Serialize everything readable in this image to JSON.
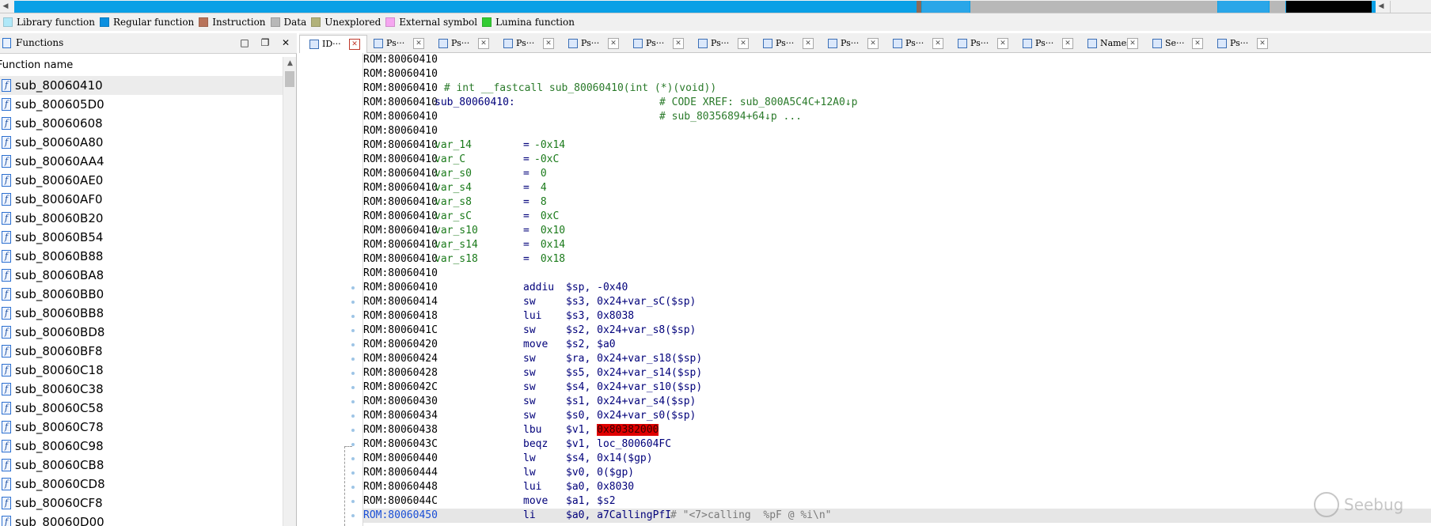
{
  "legend": [
    {
      "label": "Library function",
      "color": "#b0e8f8"
    },
    {
      "label": "Regular function",
      "color": "#0a8fe0"
    },
    {
      "label": "Instruction",
      "color": "#b8735a"
    },
    {
      "label": "Data",
      "color": "#b8b8b8"
    },
    {
      "label": "Unexplored",
      "color": "#b2b27a"
    },
    {
      "label": "External symbol",
      "color": "#f5a6f0"
    },
    {
      "label": "Lumina function",
      "color": "#33cc33"
    }
  ],
  "functions_panel": {
    "title": "Functions",
    "column_header": "Function name",
    "items": [
      "sub_80060410",
      "sub_800605D0",
      "sub_80060608",
      "sub_80060A80",
      "sub_80060AA4",
      "sub_80060AE0",
      "sub_80060AF0",
      "sub_80060B20",
      "sub_80060B54",
      "sub_80060B88",
      "sub_80060BA8",
      "sub_80060BB0",
      "sub_80060BB8",
      "sub_80060BD8",
      "sub_80060BF8",
      "sub_80060C18",
      "sub_80060C38",
      "sub_80060C58",
      "sub_80060C78",
      "sub_80060C98",
      "sub_80060CB8",
      "sub_80060CD8",
      "sub_80060CF8",
      "sub_80060D00"
    ],
    "selected_index": 0
  },
  "tabs": [
    {
      "label": "ID···",
      "active": true
    },
    {
      "label": "Ps···"
    },
    {
      "label": "Ps···"
    },
    {
      "label": "Ps···"
    },
    {
      "label": "Ps···"
    },
    {
      "label": "Ps···"
    },
    {
      "label": "Ps···"
    },
    {
      "label": "Ps···"
    },
    {
      "label": "Ps···"
    },
    {
      "label": "Ps···"
    },
    {
      "label": "Ps···"
    },
    {
      "label": "Ps···"
    },
    {
      "label": "Names"
    },
    {
      "label": "Se···"
    },
    {
      "label": "Ps···"
    }
  ],
  "disasm": {
    "lines": [
      {
        "addr": "ROM:80060410"
      },
      {
        "addr": "ROM:80060410"
      },
      {
        "addr": "ROM:80060410",
        "comment_inline": " # int __fastcall sub_80060410(int (*)(void))"
      },
      {
        "addr": "ROM:80060410",
        "label": "sub_80060410:",
        "xref": "# CODE XREF: sub_800A5C4C+12A0↓p"
      },
      {
        "addr": "ROM:80060410",
        "xref": "# sub_80356894+64↓p ..."
      },
      {
        "addr": "ROM:80060410"
      },
      {
        "addr": "ROM:80060410",
        "var": "var_14",
        "val": "-0x14"
      },
      {
        "addr": "ROM:80060410",
        "var": "var_C",
        "val": "-0xC"
      },
      {
        "addr": "ROM:80060410",
        "var": "var_s0",
        "val": " 0"
      },
      {
        "addr": "ROM:80060410",
        "var": "var_s4",
        "val": " 4"
      },
      {
        "addr": "ROM:80060410",
        "var": "var_s8",
        "val": " 8"
      },
      {
        "addr": "ROM:80060410",
        "var": "var_sC",
        "val": " 0xC"
      },
      {
        "addr": "ROM:80060410",
        "var": "var_s10",
        "val": " 0x10"
      },
      {
        "addr": "ROM:80060410",
        "var": "var_s14",
        "val": " 0x14"
      },
      {
        "addr": "ROM:80060410",
        "var": "var_s18",
        "val": " 0x18"
      },
      {
        "addr": "ROM:80060410"
      },
      {
        "addr": "ROM:80060410",
        "mn": "addiu",
        "op": "$sp, -0x40"
      },
      {
        "addr": "ROM:80060414",
        "mn": "sw",
        "op": "$s3, 0x24+var_sC($sp)"
      },
      {
        "addr": "ROM:80060418",
        "mn": "lui",
        "op": "$s3, 0x8038"
      },
      {
        "addr": "ROM:8006041C",
        "mn": "sw",
        "op": "$s2, 0x24+var_s8($sp)"
      },
      {
        "addr": "ROM:80060420",
        "mn": "move",
        "op": "$s2, $a0"
      },
      {
        "addr": "ROM:80060424",
        "mn": "sw",
        "op": "$ra, 0x24+var_s18($sp)"
      },
      {
        "addr": "ROM:80060428",
        "mn": "sw",
        "op": "$s5, 0x24+var_s14($sp)"
      },
      {
        "addr": "ROM:8006042C",
        "mn": "sw",
        "op": "$s4, 0x24+var_s10($sp)"
      },
      {
        "addr": "ROM:80060430",
        "mn": "sw",
        "op": "$s1, 0x24+var_s4($sp)"
      },
      {
        "addr": "ROM:80060434",
        "mn": "sw",
        "op": "$s0, 0x24+var_s0($sp)"
      },
      {
        "addr": "ROM:80060438",
        "mn": "lbu",
        "op": "$v1, ",
        "op_mark": "0x80382000"
      },
      {
        "addr": "ROM:8006043C",
        "mn": "beqz",
        "op": "$v1, loc_800604FC"
      },
      {
        "addr": "ROM:80060440",
        "mn": "lw",
        "op": "$s4, 0x14($gp)"
      },
      {
        "addr": "ROM:80060444",
        "mn": "lw",
        "op": "$v0, 0($gp)"
      },
      {
        "addr": "ROM:80060448",
        "mn": "lui",
        "op": "$a0, 0x8030"
      },
      {
        "addr": "ROM:8006044C",
        "mn": "move",
        "op": "$a1, $s2"
      },
      {
        "addr": "ROM:80060450",
        "mn": "li",
        "op": "$a0, a7CallingPfI",
        "tail_comment": "# \"<7>calling  %pF @ %i\\n\"",
        "highlight": true
      }
    ]
  },
  "watermark": "Seebug"
}
